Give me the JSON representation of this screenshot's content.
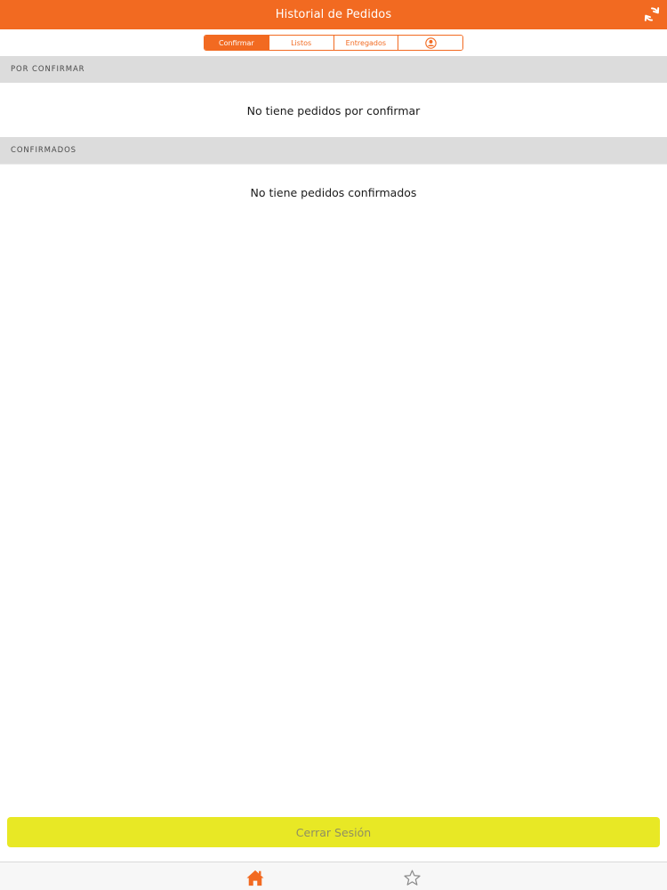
{
  "header": {
    "title": "Historial de Pedidos",
    "refresh_icon": "refresh-icon"
  },
  "tabs": [
    {
      "label": "Confirmar",
      "active": true
    },
    {
      "label": "Listos",
      "active": false
    },
    {
      "label": "Entregados",
      "active": false
    },
    {
      "label": "",
      "icon": "user-circle-icon",
      "active": false
    }
  ],
  "sections": {
    "pending": {
      "title": "POR CONFIRMAR",
      "empty_message": "No tiene pedidos por confirmar"
    },
    "confirmed": {
      "title": "CONFIRMADOS",
      "empty_message": "No tiene pedidos confirmados"
    }
  },
  "logout": {
    "label": "Cerrar Sesión"
  },
  "tabbar": {
    "items": [
      {
        "icon": "home-icon",
        "active": true
      },
      {
        "icon": "star-icon",
        "active": false
      }
    ]
  },
  "colors": {
    "brand": "#f26a21",
    "logout_bg": "#e8e825",
    "section_bg": "#dcdcdc"
  }
}
